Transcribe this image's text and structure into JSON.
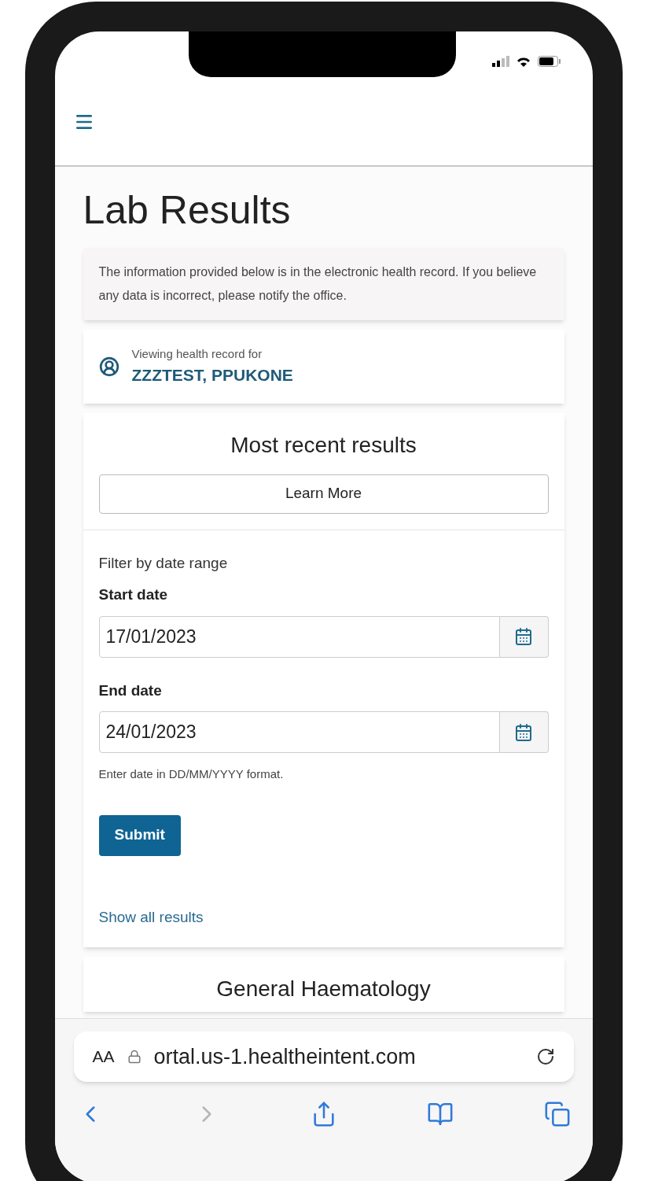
{
  "page": {
    "title": "Lab Results"
  },
  "notice": "The information provided below is in the electronic health record. If you believe any data is incorrect, please notify the office.",
  "patient": {
    "caption": "Viewing health record for",
    "name": "ZZZTEST, PPUKONE"
  },
  "recent": {
    "heading": "Most recent results",
    "learn_more": "Learn More"
  },
  "filter": {
    "caption": "Filter by date range",
    "fields": [
      {
        "label": "Start date",
        "value": "17/01/2023"
      },
      {
        "label": "End date",
        "value": "24/01/2023"
      }
    ],
    "hint": "Enter date in DD/MM/YYYY format.",
    "submit": "Submit",
    "show_all": "Show all results"
  },
  "next_section": {
    "heading": "General Haematology"
  },
  "browser": {
    "text_size": "AA",
    "url": "ortal.us-1.healtheintent.com",
    "toolbar": [
      {
        "kind": "back",
        "disabled": false
      },
      {
        "kind": "forward",
        "disabled": true
      },
      {
        "kind": "share",
        "disabled": false
      },
      {
        "kind": "bookmarks",
        "disabled": false
      },
      {
        "kind": "tabs",
        "disabled": false
      }
    ]
  }
}
